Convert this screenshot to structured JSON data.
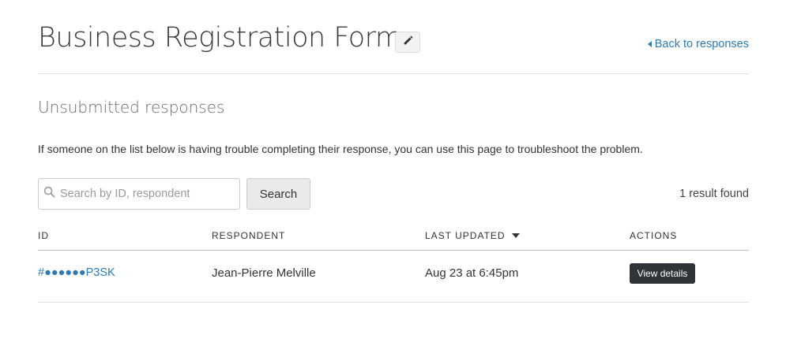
{
  "header": {
    "title": "Business Registration Form",
    "edit_icon": "pencil-icon",
    "back_link": "Back to responses",
    "back_icon": "caret-left-icon"
  },
  "section": {
    "title": "Unsubmitted responses",
    "description": "If someone on the list below is having trouble completing their response, you can use this page to troubleshoot the problem."
  },
  "search": {
    "placeholder": "Search by ID, respondent",
    "value": "",
    "button_label": "Search",
    "icon": "search-icon"
  },
  "result_count": "1 result found",
  "table": {
    "columns": [
      "ID",
      "RESPONDENT",
      "LAST UPDATED",
      "ACTIONS"
    ],
    "sorted_column": "LAST UPDATED",
    "rows": [
      {
        "id": "#●●●●●●P3SK",
        "respondent": "Jean-Pierre Melville",
        "last_updated": "Aug 23 at 6:45pm",
        "action_label": "View details"
      }
    ]
  },
  "colors": {
    "link": "#2b7bb9",
    "dark_button": "#2f3438"
  }
}
